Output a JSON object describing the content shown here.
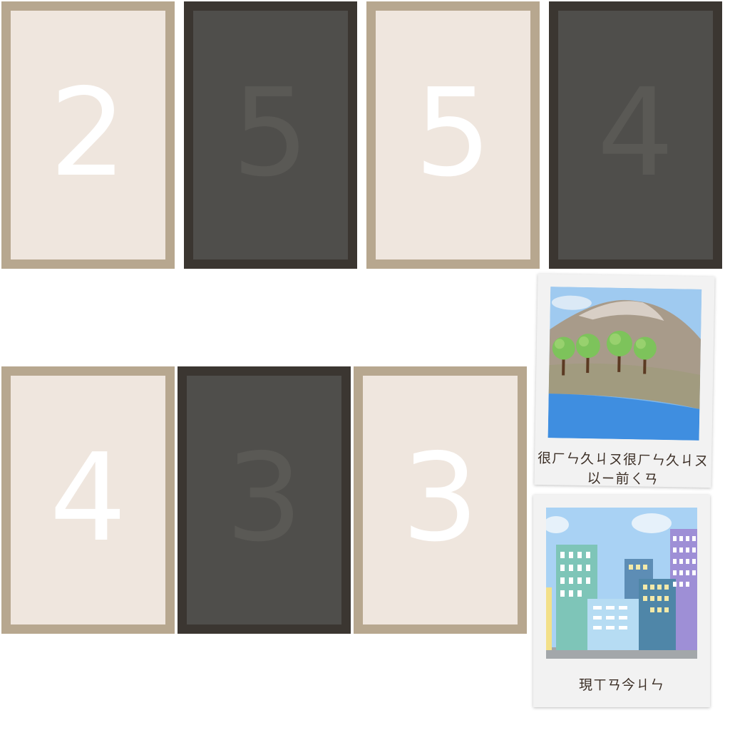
{
  "cards": [
    {
      "value": "2",
      "face": "light"
    },
    {
      "value": "5",
      "face": "dark"
    },
    {
      "value": "5",
      "face": "light"
    },
    {
      "value": "4",
      "face": "dark"
    },
    {
      "value": "4",
      "face": "light"
    },
    {
      "value": "3",
      "face": "dark"
    },
    {
      "value": "3",
      "face": "light"
    }
  ],
  "photos": [
    {
      "caption": "很ㄏㄣ久ㄐㄡ很ㄏㄣ久ㄐㄡ以ㄧ前ㄑㄢ",
      "scene": "mountain-lake-trees"
    },
    {
      "caption": "現ㄒㄢ今ㄐㄣ",
      "scene": "city-buildings"
    }
  ],
  "colors": {
    "card_light_bg": "#efe6de",
    "card_light_border": "#b7a78f",
    "card_dark_bg": "#4f4e4b",
    "card_dark_border": "#3b3631"
  }
}
